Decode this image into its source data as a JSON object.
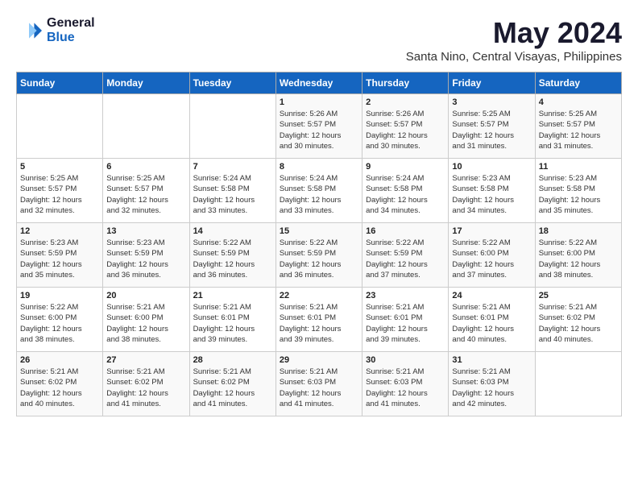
{
  "logo": {
    "general": "General",
    "blue": "Blue"
  },
  "title": "May 2024",
  "location": "Santa Nino, Central Visayas, Philippines",
  "days_of_week": [
    "Sunday",
    "Monday",
    "Tuesday",
    "Wednesday",
    "Thursday",
    "Friday",
    "Saturday"
  ],
  "weeks": [
    [
      {
        "day": "",
        "info": ""
      },
      {
        "day": "",
        "info": ""
      },
      {
        "day": "",
        "info": ""
      },
      {
        "day": "1",
        "info": "Sunrise: 5:26 AM\nSunset: 5:57 PM\nDaylight: 12 hours\nand 30 minutes."
      },
      {
        "day": "2",
        "info": "Sunrise: 5:26 AM\nSunset: 5:57 PM\nDaylight: 12 hours\nand 30 minutes."
      },
      {
        "day": "3",
        "info": "Sunrise: 5:25 AM\nSunset: 5:57 PM\nDaylight: 12 hours\nand 31 minutes."
      },
      {
        "day": "4",
        "info": "Sunrise: 5:25 AM\nSunset: 5:57 PM\nDaylight: 12 hours\nand 31 minutes."
      }
    ],
    [
      {
        "day": "5",
        "info": "Sunrise: 5:25 AM\nSunset: 5:57 PM\nDaylight: 12 hours\nand 32 minutes."
      },
      {
        "day": "6",
        "info": "Sunrise: 5:25 AM\nSunset: 5:57 PM\nDaylight: 12 hours\nand 32 minutes."
      },
      {
        "day": "7",
        "info": "Sunrise: 5:24 AM\nSunset: 5:58 PM\nDaylight: 12 hours\nand 33 minutes."
      },
      {
        "day": "8",
        "info": "Sunrise: 5:24 AM\nSunset: 5:58 PM\nDaylight: 12 hours\nand 33 minutes."
      },
      {
        "day": "9",
        "info": "Sunrise: 5:24 AM\nSunset: 5:58 PM\nDaylight: 12 hours\nand 34 minutes."
      },
      {
        "day": "10",
        "info": "Sunrise: 5:23 AM\nSunset: 5:58 PM\nDaylight: 12 hours\nand 34 minutes."
      },
      {
        "day": "11",
        "info": "Sunrise: 5:23 AM\nSunset: 5:58 PM\nDaylight: 12 hours\nand 35 minutes."
      }
    ],
    [
      {
        "day": "12",
        "info": "Sunrise: 5:23 AM\nSunset: 5:59 PM\nDaylight: 12 hours\nand 35 minutes."
      },
      {
        "day": "13",
        "info": "Sunrise: 5:23 AM\nSunset: 5:59 PM\nDaylight: 12 hours\nand 36 minutes."
      },
      {
        "day": "14",
        "info": "Sunrise: 5:22 AM\nSunset: 5:59 PM\nDaylight: 12 hours\nand 36 minutes."
      },
      {
        "day": "15",
        "info": "Sunrise: 5:22 AM\nSunset: 5:59 PM\nDaylight: 12 hours\nand 36 minutes."
      },
      {
        "day": "16",
        "info": "Sunrise: 5:22 AM\nSunset: 5:59 PM\nDaylight: 12 hours\nand 37 minutes."
      },
      {
        "day": "17",
        "info": "Sunrise: 5:22 AM\nSunset: 6:00 PM\nDaylight: 12 hours\nand 37 minutes."
      },
      {
        "day": "18",
        "info": "Sunrise: 5:22 AM\nSunset: 6:00 PM\nDaylight: 12 hours\nand 38 minutes."
      }
    ],
    [
      {
        "day": "19",
        "info": "Sunrise: 5:22 AM\nSunset: 6:00 PM\nDaylight: 12 hours\nand 38 minutes."
      },
      {
        "day": "20",
        "info": "Sunrise: 5:21 AM\nSunset: 6:00 PM\nDaylight: 12 hours\nand 38 minutes."
      },
      {
        "day": "21",
        "info": "Sunrise: 5:21 AM\nSunset: 6:01 PM\nDaylight: 12 hours\nand 39 minutes."
      },
      {
        "day": "22",
        "info": "Sunrise: 5:21 AM\nSunset: 6:01 PM\nDaylight: 12 hours\nand 39 minutes."
      },
      {
        "day": "23",
        "info": "Sunrise: 5:21 AM\nSunset: 6:01 PM\nDaylight: 12 hours\nand 39 minutes."
      },
      {
        "day": "24",
        "info": "Sunrise: 5:21 AM\nSunset: 6:01 PM\nDaylight: 12 hours\nand 40 minutes."
      },
      {
        "day": "25",
        "info": "Sunrise: 5:21 AM\nSunset: 6:02 PM\nDaylight: 12 hours\nand 40 minutes."
      }
    ],
    [
      {
        "day": "26",
        "info": "Sunrise: 5:21 AM\nSunset: 6:02 PM\nDaylight: 12 hours\nand 40 minutes."
      },
      {
        "day": "27",
        "info": "Sunrise: 5:21 AM\nSunset: 6:02 PM\nDaylight: 12 hours\nand 41 minutes."
      },
      {
        "day": "28",
        "info": "Sunrise: 5:21 AM\nSunset: 6:02 PM\nDaylight: 12 hours\nand 41 minutes."
      },
      {
        "day": "29",
        "info": "Sunrise: 5:21 AM\nSunset: 6:03 PM\nDaylight: 12 hours\nand 41 minutes."
      },
      {
        "day": "30",
        "info": "Sunrise: 5:21 AM\nSunset: 6:03 PM\nDaylight: 12 hours\nand 41 minutes."
      },
      {
        "day": "31",
        "info": "Sunrise: 5:21 AM\nSunset: 6:03 PM\nDaylight: 12 hours\nand 42 minutes."
      },
      {
        "day": "",
        "info": ""
      }
    ]
  ]
}
